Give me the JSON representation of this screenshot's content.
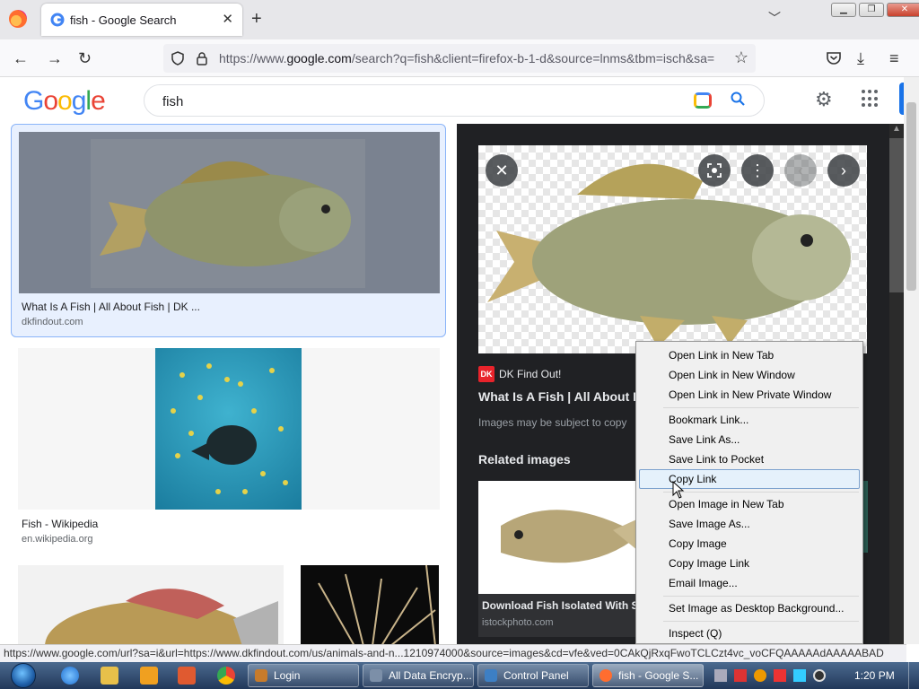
{
  "browser": {
    "tab_title": "fish - Google Search",
    "close_tab": "✕",
    "new_tab": "+",
    "url_prefix": "https://www.",
    "url_host": "google.com",
    "url_rest": "/search?q=fish&client=firefox-b-1-d&source=lnms&tbm=isch&sa=",
    "status_url": "https://www.google.com/url?sa=i&url=https://www.dkfindout.com/us/animals-and-n...1210974000&source=images&cd=vfe&ved=0CAkQjRxqFwoTCLCzt4vc_voCFQAAAAAdAAAAABAD"
  },
  "google": {
    "logo_letters": [
      "G",
      "o",
      "o",
      "g",
      "l",
      "e"
    ],
    "logo_colors": [
      "#4285f4",
      "#ea4335",
      "#fbbc05",
      "#4285f4",
      "#34a853",
      "#ea4335"
    ],
    "query": "fish"
  },
  "results": [
    {
      "title": "What Is A Fish | All About Fish | DK ...",
      "source": "dkfindout.com"
    },
    {
      "title": "Fish - Wikipedia",
      "source": "en.wikipedia.org"
    }
  ],
  "panel": {
    "badge": "DK",
    "source_name": "DK Find Out!",
    "title": "What Is A Fish | All About F",
    "note": "Images may be subject to copy",
    "related_heading": "Related images",
    "related": [
      {
        "title": "Download Fish Isolated With So",
        "source": "istockphoto.com"
      }
    ],
    "close": "✕",
    "prev": "‹",
    "next": "›",
    "more": "⋮"
  },
  "context_menu": {
    "items": [
      "Open Link in New Tab",
      "Open Link in New Window",
      "Open Link in New Private Window",
      "Bookmark Link...",
      "Save Link As...",
      "Save Link to Pocket",
      "Copy Link",
      "Open Image in New Tab",
      "Save Image As...",
      "Copy Image",
      "Copy Image Link",
      "Email Image...",
      "Set Image as Desktop Background...",
      "Inspect (Q)"
    ],
    "highlighted": "Copy Link"
  },
  "taskbar": {
    "buttons": [
      {
        "label": "Login",
        "color": "#c77b2b"
      },
      {
        "label": "All Data Encryp...",
        "color": "#7c8fa8"
      },
      {
        "label": "Control Panel",
        "color": "#3d7fc4"
      },
      {
        "label": "fish - Google S...",
        "color": "#ff6d2f"
      }
    ],
    "clock": "1:20 PM"
  }
}
